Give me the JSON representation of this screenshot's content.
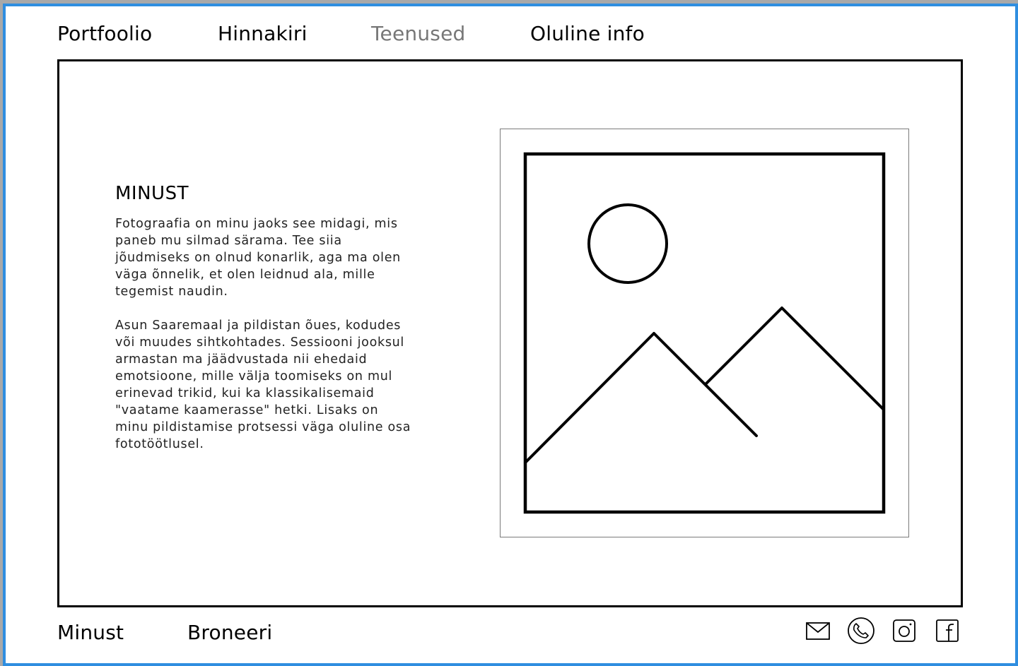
{
  "nav": {
    "items": [
      {
        "label": "Portfoolio",
        "active": false
      },
      {
        "label": "Hinnakiri",
        "active": false
      },
      {
        "label": "Teenused",
        "active": true
      },
      {
        "label": "Oluline info",
        "active": false
      }
    ]
  },
  "about": {
    "title": "MINUST",
    "paragraphs": [
      "Fotograafia on minu jaoks see midagi, mis paneb mu silmad särama. Tee siia jõudmiseks on olnud konarlik, aga ma olen väga õnnelik, et olen leidnud ala, mille tegemist naudin.",
      "Asun Saaremaal ja pildistan õues, kodudes või muudes sihtkohtades. Sessiooni jooksul armastan ma jäädvustada nii ehedaid emotsioone, mille välja toomiseks on mul erinevad trikid, kui ka klassikalisemaid \"vaatame kaamerasse\" hetki. Lisaks on minu pildistamise protsessi väga oluline osa fototöötlusel."
    ],
    "image_icon": "image-placeholder-icon"
  },
  "footer": {
    "links": [
      "Minust",
      "Broneeri"
    ],
    "social": [
      "mail-icon",
      "phone-icon",
      "instagram-icon",
      "facebook-icon"
    ]
  },
  "colors": {
    "frame_border": "#2f8ee0",
    "active_nav": "#777777",
    "text": "#000000"
  }
}
